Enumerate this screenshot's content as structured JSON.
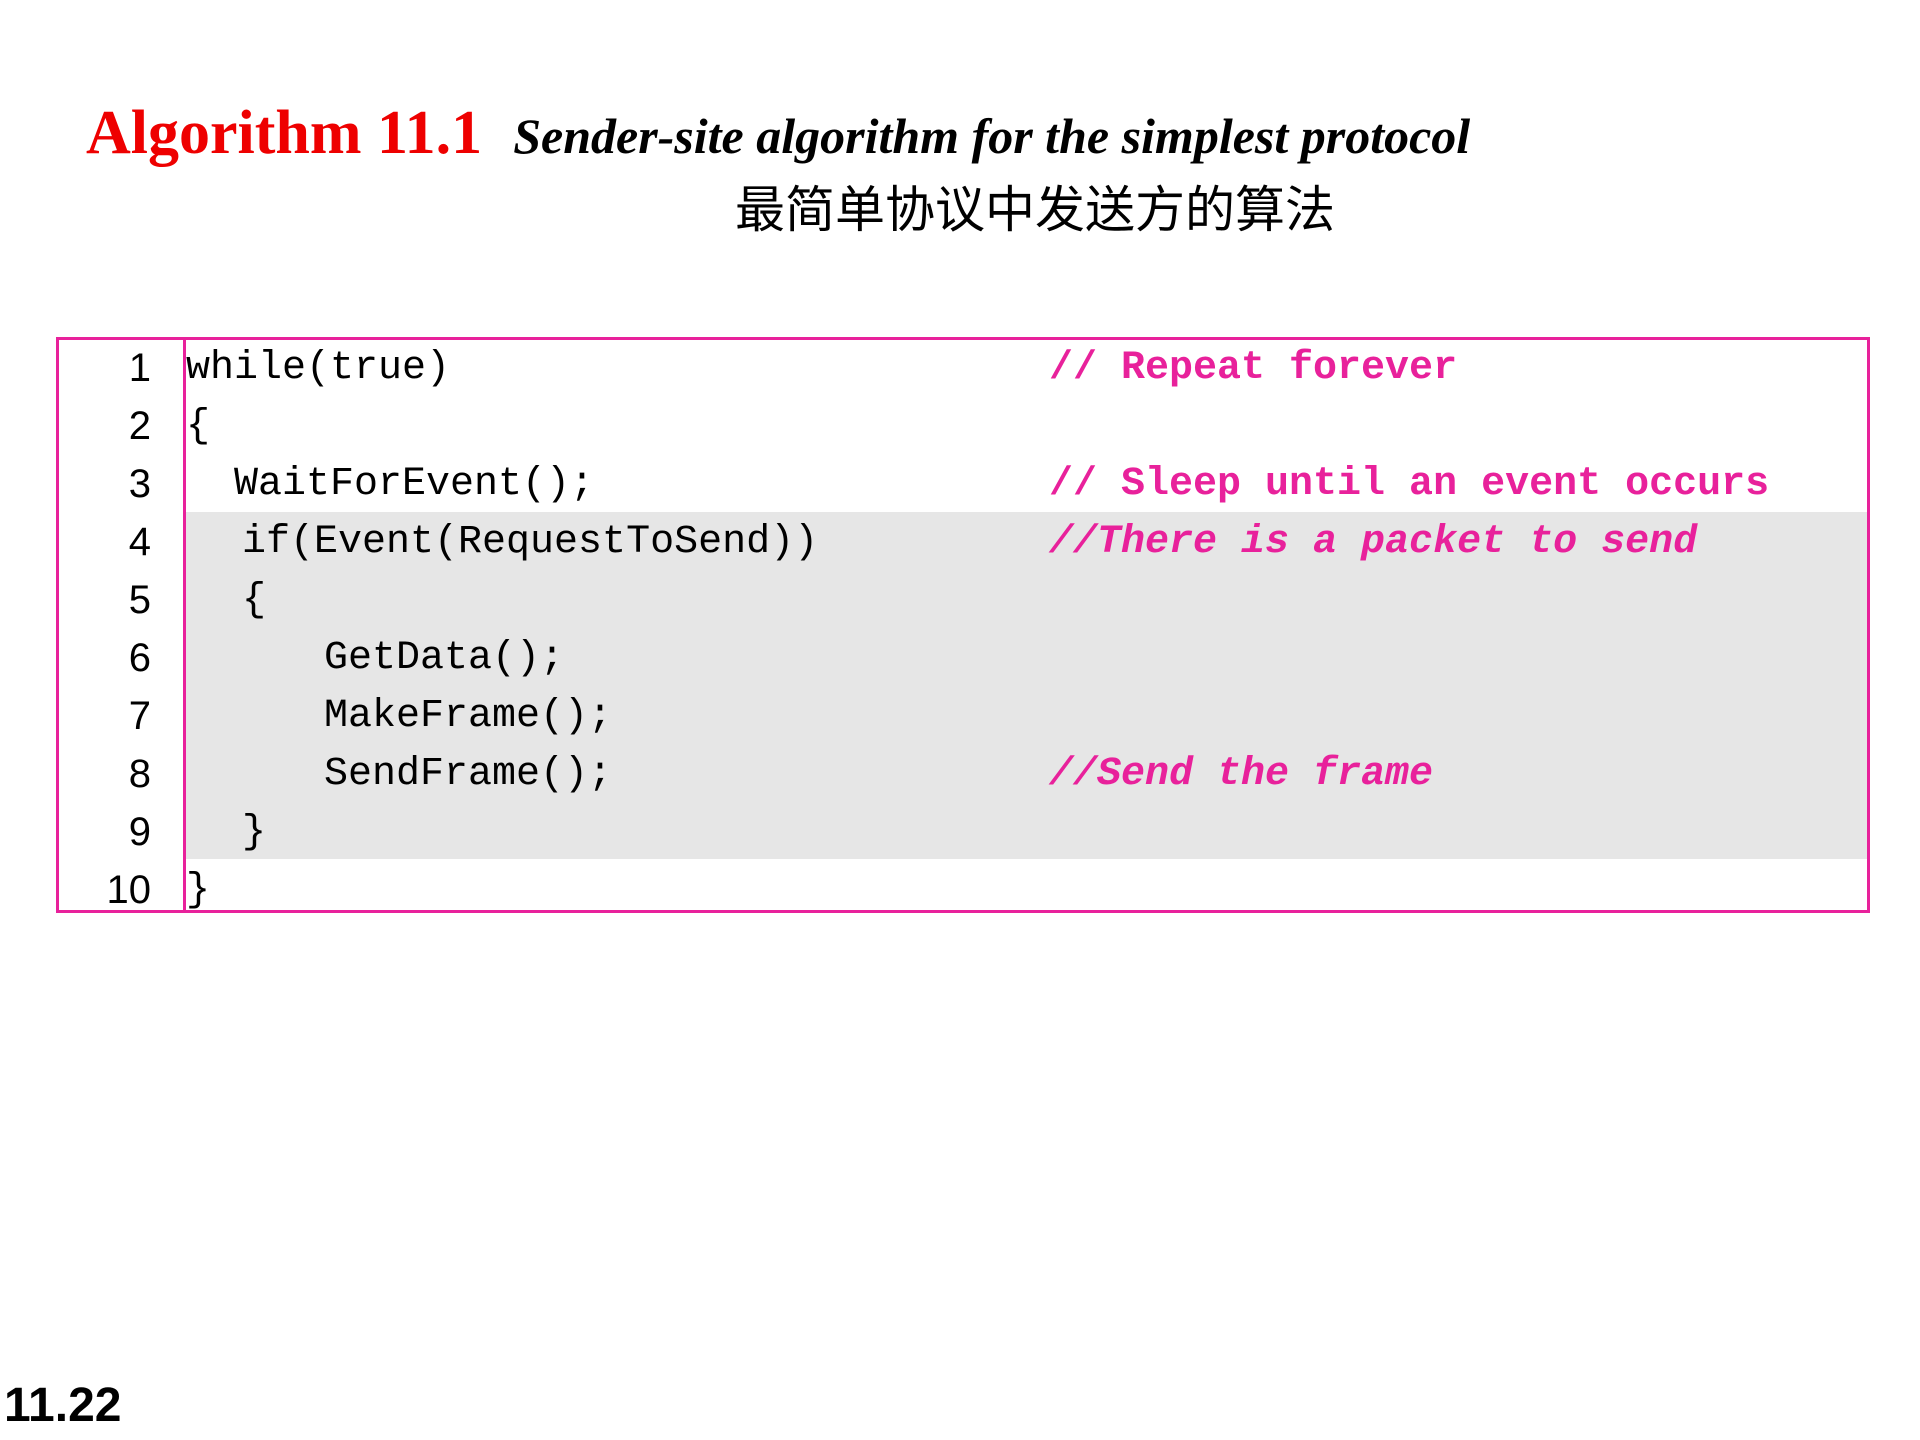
{
  "heading": {
    "label": "Algorithm 11.1",
    "caption": "Sender-site algorithm for the simplest protocol",
    "subtitle": "最简单协议中发送方的算法",
    "label_color": "#ee0000"
  },
  "code": {
    "border_color": "#e8219b",
    "comment_color": "#e8219b",
    "highlight_color": "#e6e6e6",
    "lines": [
      {
        "num": "1",
        "text": "while(true)",
        "comment": "// Repeat forever"
      },
      {
        "num": "2",
        "text": "{",
        "comment": ""
      },
      {
        "num": "3",
        "text": "WaitForEvent();",
        "comment": "// Sleep until an event occurs"
      },
      {
        "num": "4",
        "text": "if(Event(RequestToSend))",
        "comment": "//There is a packet to send"
      },
      {
        "num": "5",
        "text": "{",
        "comment": ""
      },
      {
        "num": "6",
        "text": "GetData();",
        "comment": ""
      },
      {
        "num": "7",
        "text": "MakeFrame();",
        "comment": ""
      },
      {
        "num": "8",
        "text": "SendFrame();",
        "comment": "//Send the frame"
      },
      {
        "num": "9",
        "text": "}",
        "comment": ""
      },
      {
        "num": "10",
        "text": "}",
        "comment": ""
      }
    ]
  },
  "footer": {
    "slide_number": "11.22"
  }
}
